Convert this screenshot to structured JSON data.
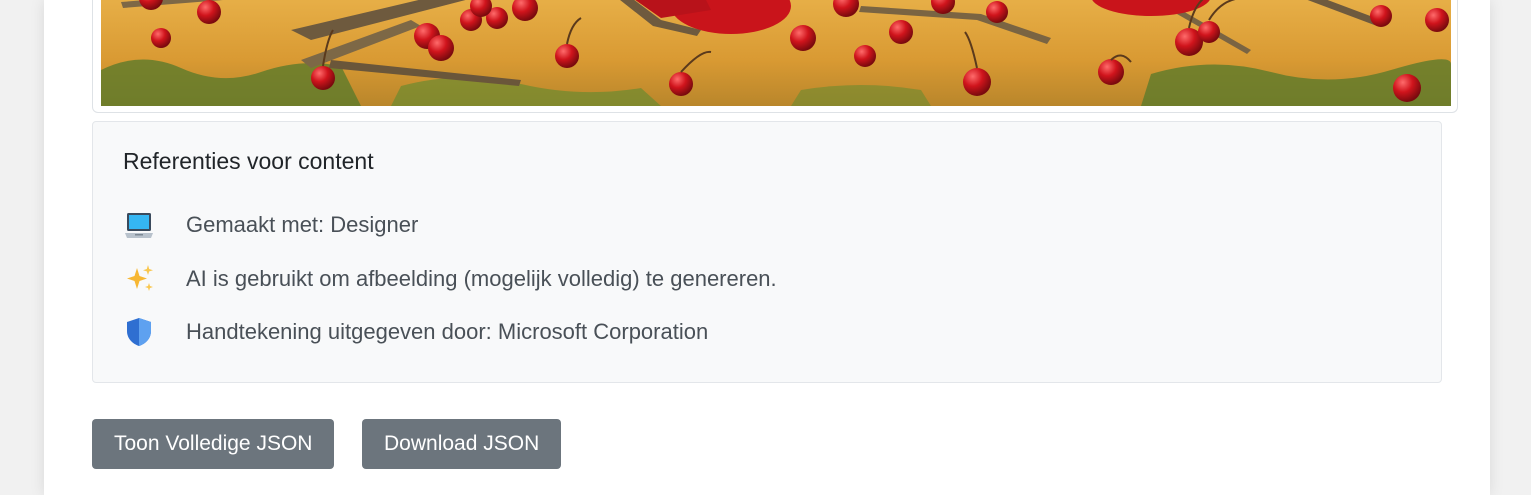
{
  "credits": {
    "title": "Referenties voor content",
    "items": [
      {
        "icon": "laptop-icon",
        "text": "Gemaakt met: Designer"
      },
      {
        "icon": "sparkles-icon",
        "text": "AI is gebruikt om afbeelding (mogelijk volledig) te genereren."
      },
      {
        "icon": "shield-icon",
        "text": "Handtekening uitgegeven door: Microsoft Corporation"
      }
    ]
  },
  "buttons": {
    "show_json": "Toon Volledige JSON",
    "download_json": "Download JSON"
  },
  "colors": {
    "button_bg": "#6c757d",
    "panel_bg": "#f8f9fa",
    "cherry": "#d0141c",
    "ground": "#e0a83a"
  }
}
